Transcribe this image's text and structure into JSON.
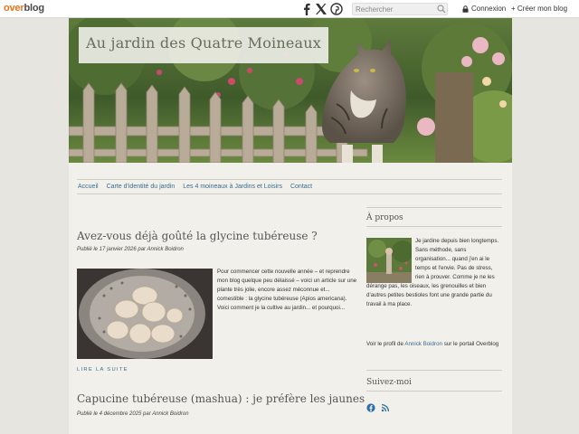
{
  "topbar": {
    "logo_a": "over",
    "logo_b": "blog",
    "search_placeholder": "Rechercher",
    "login_label": "Connexion",
    "create_label": "+ Créer mon blog",
    "social_icons": [
      "facebook-icon",
      "x-twitter-icon",
      "pinterest-icon"
    ]
  },
  "site": {
    "title": "Au jardin des Quatre Moineaux"
  },
  "nav": {
    "items": [
      {
        "label": "Accueil"
      },
      {
        "label": "Carte d'identité du jardin"
      },
      {
        "label": "Les 4 moineaux à Jardins et Loisirs"
      },
      {
        "label": "Contact"
      }
    ]
  },
  "posts": [
    {
      "title": "Avez-vous déjà goûté la glycine tubéreuse ?",
      "meta_prefix": "Publié le 17 janvier 2026 par",
      "author": "Annick Boidron",
      "excerpt": "Pour commencer cette nouvelle année – et reprendre mon blog quelque peu délaissé – voici un article sur une plante très jolie, encore assez méconnue et... comestible : la glycine tubéreuse (Apios americana). Voici comment je la cultive au jardin... et pourquoi...",
      "read_more": "LIRE LA SUITE"
    },
    {
      "title": "Capucine tubéreuse (mashua) : je préfère les jaunes",
      "meta_prefix": "Publié le 4 décembre 2025 par",
      "author": "Annick Boidron"
    }
  ],
  "sidebar": {
    "about_heading": "À propos",
    "about_text": "Je jardine depuis bien longtemps. Sans méthode, sans organisation... quand j'en ai le temps et l'envie. Pas de stress, rien à prouver. Comme je ne les dérange pas, les oiseaux, les grenouilles et bien d'autres petites bestioles font une grande partie du travail à ma place.",
    "profile_prefix": "Voir le profil de",
    "profile_name": "Annick Boidron",
    "profile_suffix": "sur le portail Overblog",
    "follow_heading": "Suivez-moi",
    "follow_icons": [
      "facebook-icon",
      "rss-icon"
    ]
  },
  "colors": {
    "brand_orange": "#e8731d",
    "link_blue": "#3a6a8f",
    "page_bg": "#f1f0eb",
    "outer_bg": "#e6e5e0"
  }
}
